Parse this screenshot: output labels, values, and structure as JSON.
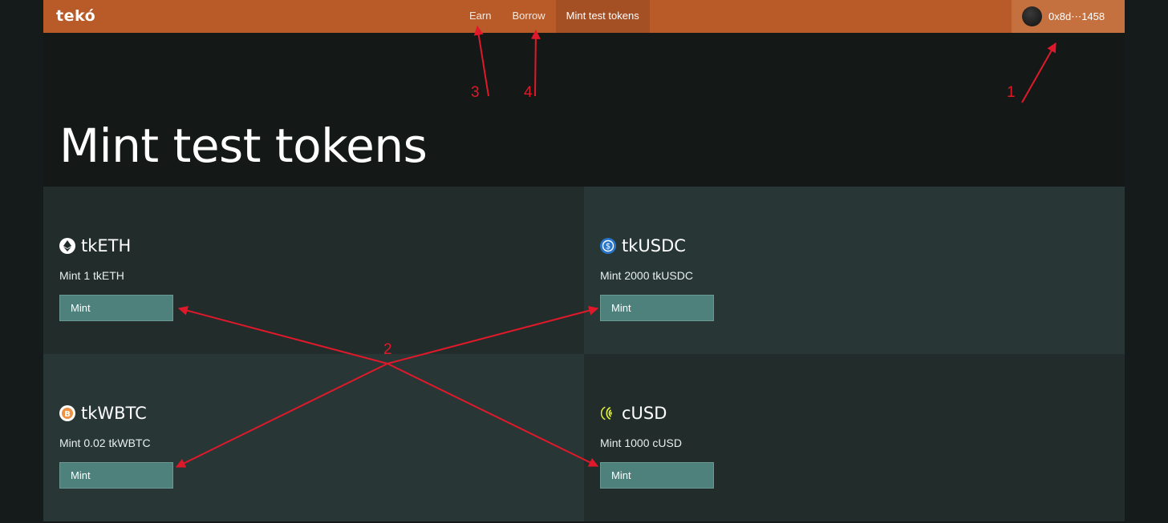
{
  "header": {
    "logo": "tekó",
    "nav": [
      {
        "label": "Earn"
      },
      {
        "label": "Borrow"
      },
      {
        "label": "Mint test tokens"
      }
    ],
    "wallet_address": "0x8d⋯1458"
  },
  "page_title": "Mint test tokens",
  "tokens": [
    {
      "name": "tkETH",
      "description": "Mint 1 tkETH",
      "button": "Mint",
      "icon": "ethereum-icon"
    },
    {
      "name": "tkUSDC",
      "description": "Mint 2000 tkUSDC",
      "button": "Mint",
      "icon": "usdc-icon"
    },
    {
      "name": "tkWBTC",
      "description": "Mint 0.02 tkWBTC",
      "button": "Mint",
      "icon": "bitcoin-icon"
    },
    {
      "name": "cUSD",
      "description": "Mint 1000 cUSD",
      "button": "Mint",
      "icon": "celo-dollar-icon"
    }
  ],
  "annotations": [
    "1",
    "2",
    "3",
    "4"
  ],
  "colors": {
    "header": "#b95a29",
    "active_nav": "#a44f24",
    "wallet": "#c5703f",
    "button": "#4e807c",
    "annotation": "#e0192a"
  }
}
